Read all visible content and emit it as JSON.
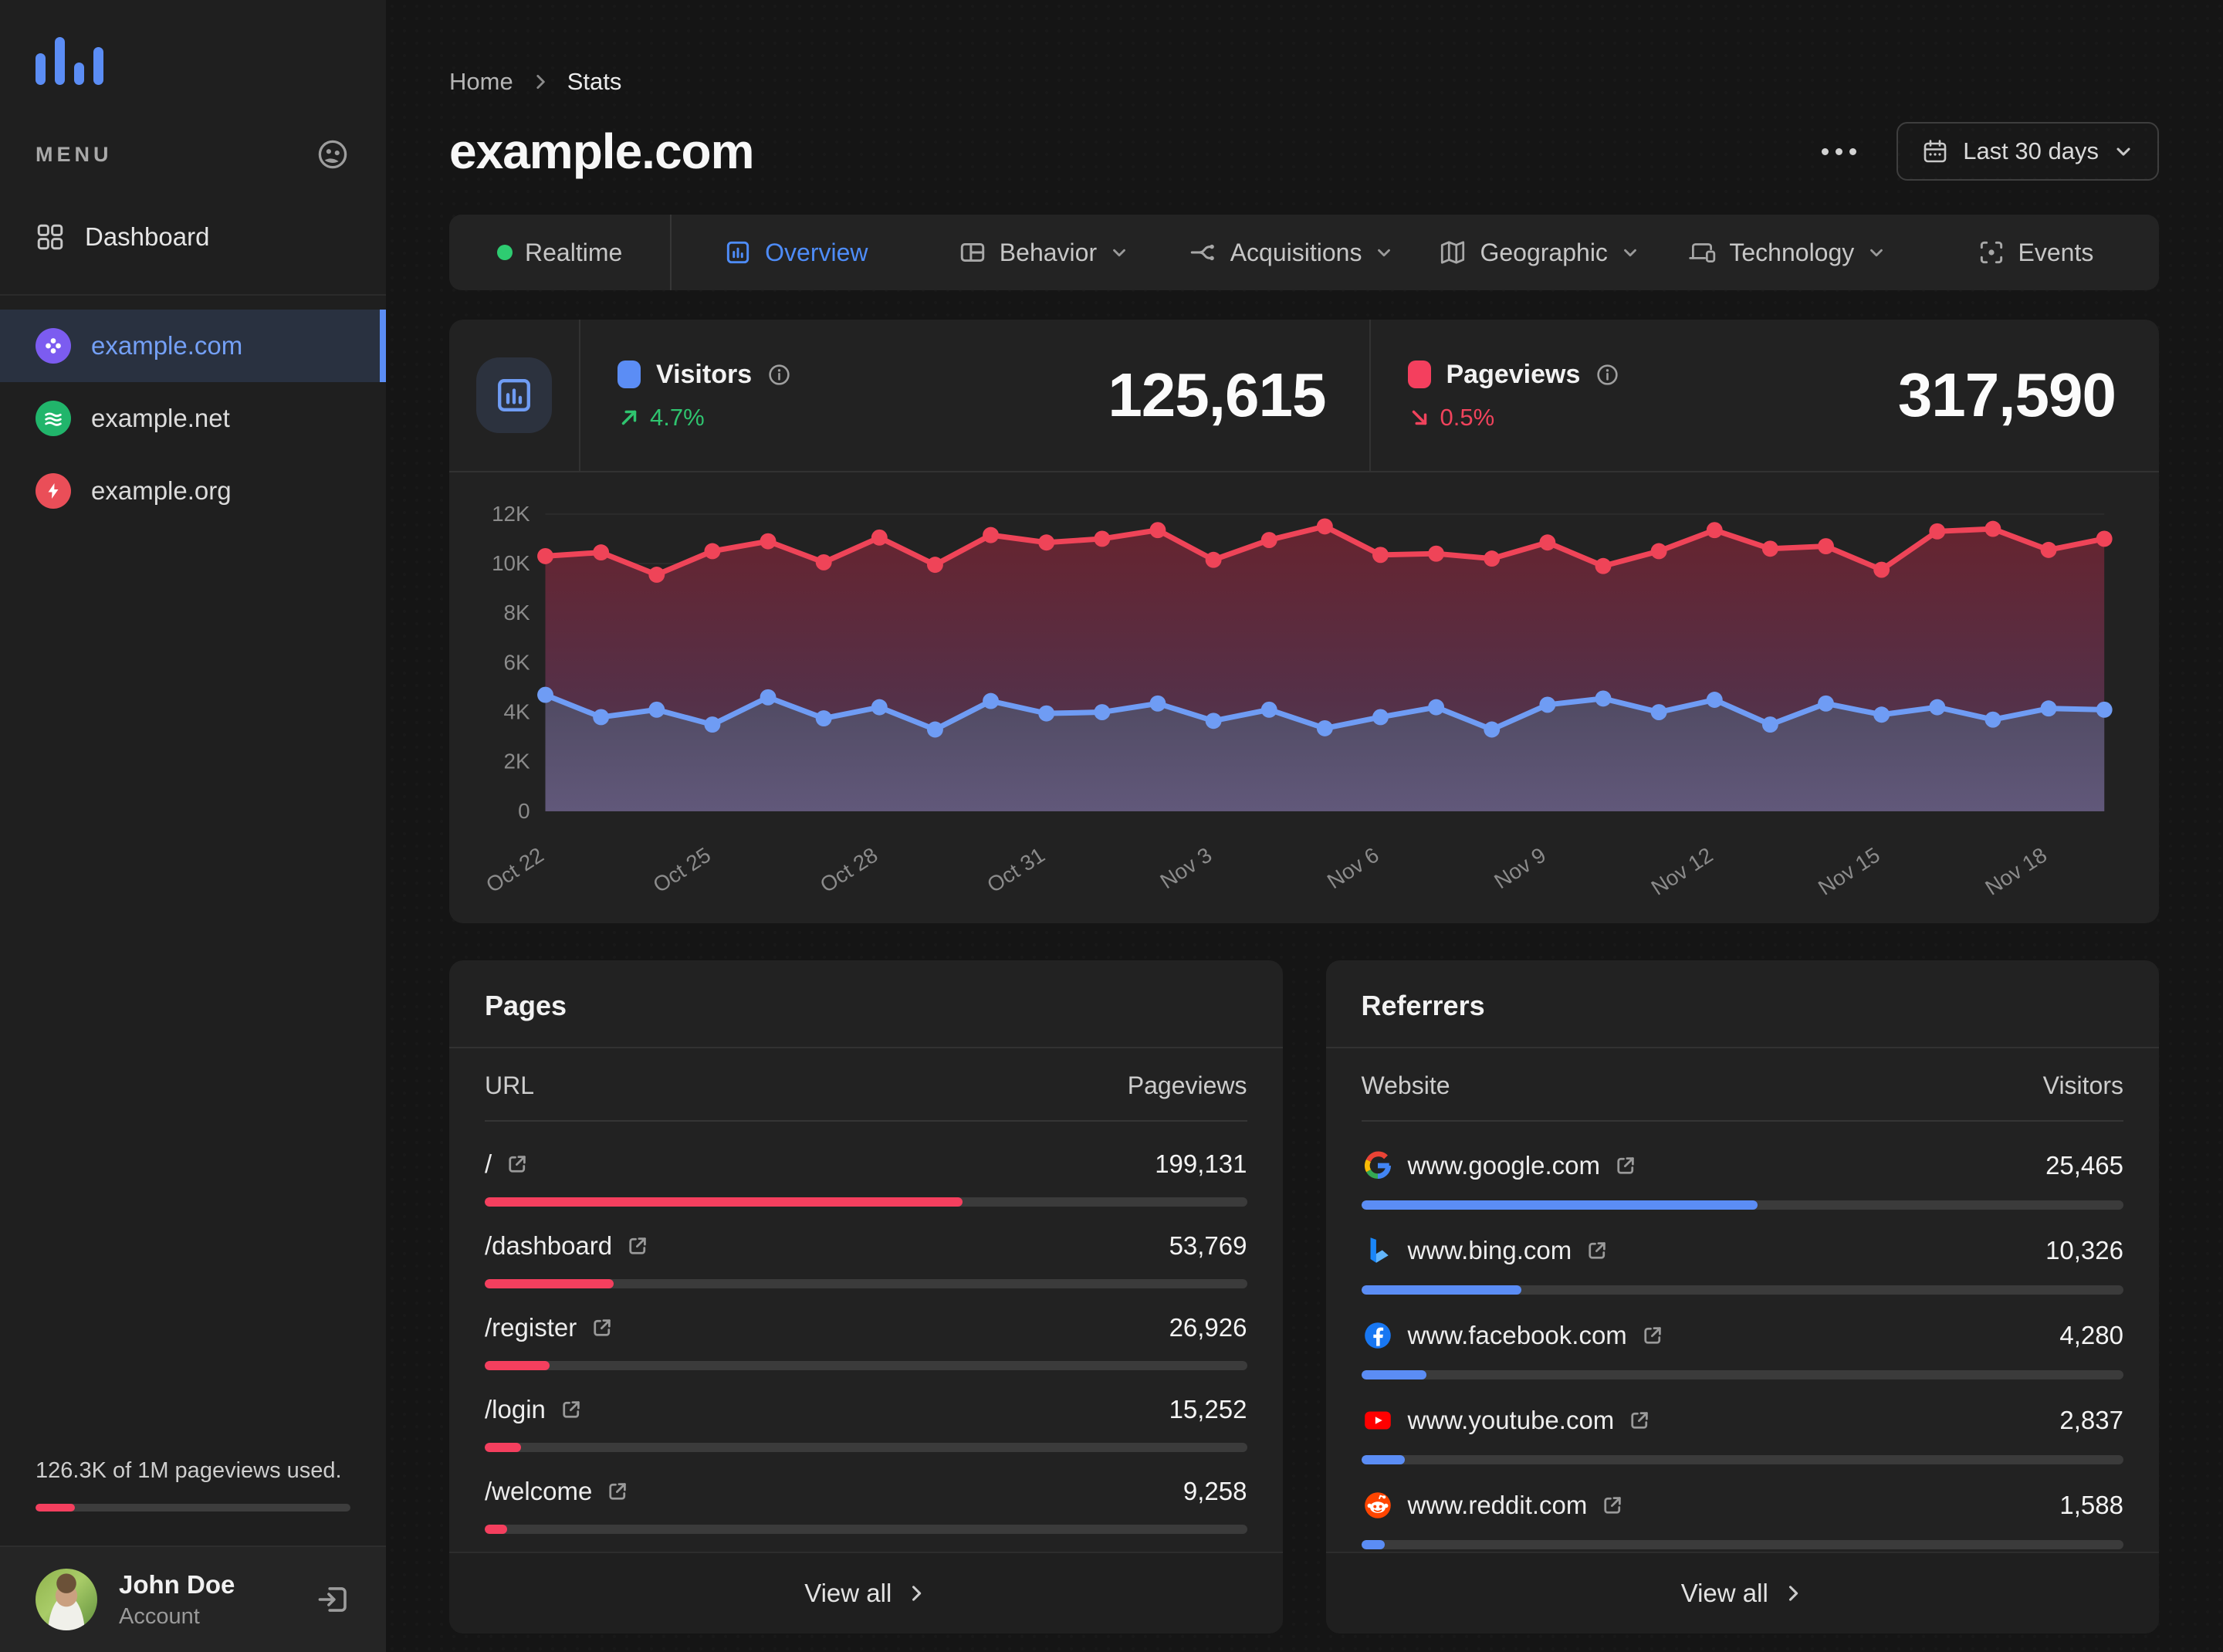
{
  "colors": {
    "accent_blue": "#5b8df5",
    "chart_blue": "#6f9cf4",
    "accent_red": "#f43f5e",
    "chart_red": "#ef4458",
    "green": "#2fc46f"
  },
  "sidebar": {
    "menu_label": "MENU",
    "dashboard_label": "Dashboard",
    "sites": [
      {
        "name": "example.com",
        "icon": "clover-icon",
        "color": "#7c5cf0",
        "active": true
      },
      {
        "name": "example.net",
        "icon": "waves-icon",
        "color": "#21b56b",
        "active": false
      },
      {
        "name": "example.org",
        "icon": "bolt-icon",
        "color": "#ea4e58",
        "active": false
      }
    ],
    "usage_text": "126.3K of 1M pageviews used.",
    "usage_pct": 12.6,
    "user": {
      "name": "John Doe",
      "role": "Account"
    }
  },
  "header": {
    "breadcrumb": {
      "home": "Home",
      "current": "Stats"
    },
    "title": "example.com",
    "date_range_label": "Last 30 days"
  },
  "tabs": [
    {
      "label": "Realtime",
      "icon": "realtime-dot",
      "chevron": false,
      "active": false
    },
    {
      "label": "Overview",
      "icon": "chart-icon",
      "chevron": false,
      "active": true
    },
    {
      "label": "Behavior",
      "icon": "layout-icon",
      "chevron": true,
      "active": false
    },
    {
      "label": "Acquisitions",
      "icon": "branch-icon",
      "chevron": true,
      "active": false
    },
    {
      "label": "Geographic",
      "icon": "map-icon",
      "chevron": true,
      "active": false
    },
    {
      "label": "Technology",
      "icon": "devices-icon",
      "chevron": true,
      "active": false
    },
    {
      "label": "Events",
      "icon": "scan-icon",
      "chevron": false,
      "active": false
    }
  ],
  "stats": [
    {
      "label": "Visitors",
      "value": "125,615",
      "delta": "4.7%",
      "direction": "up",
      "swatch": "#5b8df5"
    },
    {
      "label": "Pageviews",
      "value": "317,590",
      "delta": "0.5%",
      "direction": "down",
      "swatch": "#f43f5e"
    }
  ],
  "chart_data": {
    "type": "line",
    "title": "Visitors vs Pageviews, last 30 days",
    "x_labels": [
      "Oct 22",
      "Oct 25",
      "Oct 28",
      "Oct 31",
      "Nov 3",
      "Nov 6",
      "Nov 9",
      "Nov 12",
      "Nov 15",
      "Nov 18"
    ],
    "label_every": 3,
    "ylim": [
      0,
      12000
    ],
    "y_ticks": [
      "0",
      "2K",
      "4K",
      "6K",
      "8K",
      "10K",
      "12K"
    ],
    "grid": true,
    "legend_position": "in stats header row",
    "series": [
      {
        "name": "Pageviews",
        "color": "#ef4458",
        "values": [
          10300,
          10450,
          9550,
          10500,
          10900,
          10050,
          11050,
          9950,
          11150,
          10850,
          11000,
          11350,
          10150,
          10950,
          11500,
          10350,
          10400,
          10200,
          10850,
          9900,
          10500,
          11350,
          10600,
          10700,
          9750,
          11300,
          11400,
          10550,
          11000
        ]
      },
      {
        "name": "Visitors",
        "color": "#6f9cf4",
        "values": [
          4700,
          3800,
          4100,
          3500,
          4600,
          3750,
          4200,
          3300,
          4450,
          3950,
          4000,
          4350,
          3650,
          4100,
          3350,
          3800,
          4200,
          3300,
          4300,
          4550,
          4000,
          4500,
          3500,
          4350,
          3900,
          4200,
          3700,
          4150,
          4100
        ]
      }
    ]
  },
  "pages_panel": {
    "title": "Pages",
    "columns": {
      "label": "URL",
      "value": "Pageviews"
    },
    "bar_color": "#f43f5e",
    "rows": [
      {
        "label": "/",
        "value": "199,131",
        "pct": 62.7
      },
      {
        "label": "/dashboard",
        "value": "53,769",
        "pct": 16.9
      },
      {
        "label": "/register",
        "value": "26,926",
        "pct": 8.5
      },
      {
        "label": "/login",
        "value": "15,252",
        "pct": 4.8
      },
      {
        "label": "/welcome",
        "value": "9,258",
        "pct": 2.9
      }
    ],
    "footer": "View all"
  },
  "referrers_panel": {
    "title": "Referrers",
    "columns": {
      "label": "Website",
      "value": "Visitors"
    },
    "bar_color": "#5b8df5",
    "rows": [
      {
        "label": "www.google.com",
        "value": "25,465",
        "pct": 52.0,
        "favicon": "google-icon"
      },
      {
        "label": "www.bing.com",
        "value": "10,326",
        "pct": 21.0,
        "favicon": "bing-icon"
      },
      {
        "label": "www.facebook.com",
        "value": "4,280",
        "pct": 8.6,
        "favicon": "facebook-icon"
      },
      {
        "label": "www.youtube.com",
        "value": "2,837",
        "pct": 5.7,
        "favicon": "youtube-icon"
      },
      {
        "label": "www.reddit.com",
        "value": "1,588",
        "pct": 3.1,
        "favicon": "reddit-icon"
      }
    ],
    "footer": "View all"
  }
}
